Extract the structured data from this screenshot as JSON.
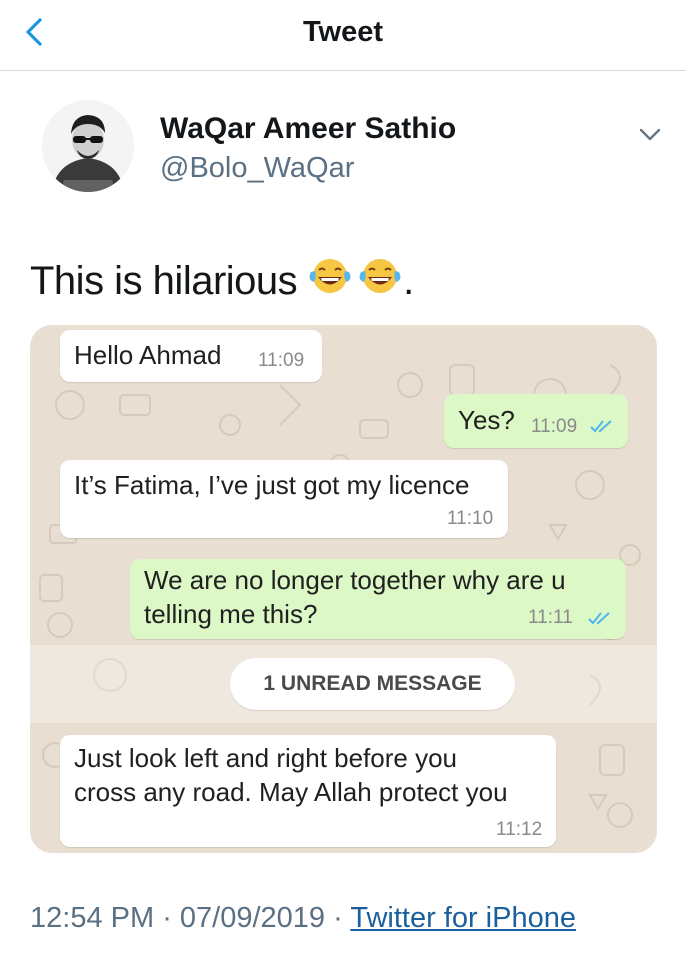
{
  "header": {
    "title": "Tweet"
  },
  "author": {
    "name": "WaQar Ameer Sathio",
    "handle": "@Bolo_WaQar"
  },
  "tweet": {
    "text": "This is hilarious",
    "trailing": "."
  },
  "chat": {
    "messages": [
      {
        "side": "in",
        "text": "Hello Ahmad",
        "time": "11:09"
      },
      {
        "side": "out",
        "text": "Yes?",
        "time": "11:09"
      },
      {
        "side": "in",
        "text": "It’s Fatima, I’ve just got my licence",
        "time": "11:10"
      },
      {
        "side": "out",
        "line1": "We are no longer together why are u",
        "line2": "telling me this?",
        "time": "11:11"
      },
      {
        "side": "in",
        "line1": "Just look left and right before you",
        "line2": "cross any road. May Allah protect you",
        "time": "11:12"
      }
    ],
    "unread_label": "1 UNREAD MESSAGE"
  },
  "footer": {
    "time": "12:54 PM",
    "date": "07/09/2019",
    "separator": " · ",
    "source": "Twitter for iPhone"
  },
  "colors": {
    "out_bubble": "#dcf8c6",
    "chat_bg": "#e8dfd2",
    "link": "#1b5f9c",
    "tick": "#4fb6ec"
  },
  "icons": [
    "back-chevron-icon",
    "chevron-down-icon",
    "tears-of-joy-emoji-icon",
    "double-check-icon"
  ]
}
